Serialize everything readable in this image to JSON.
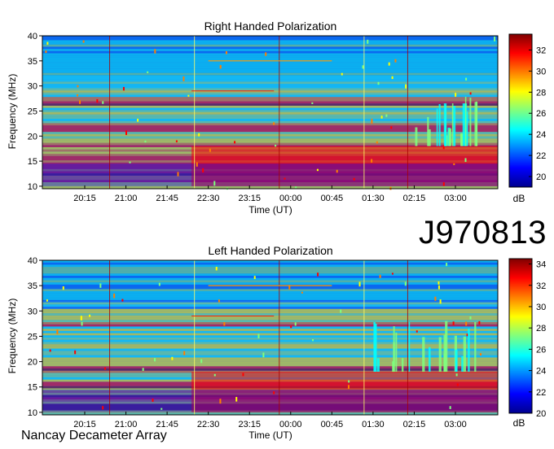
{
  "identifier": "J970813",
  "footer": "Nancay Decameter Array",
  "colors": {
    "colormap": [
      "#00008f",
      "#0000ff",
      "#007fff",
      "#00ffff",
      "#7fff7f",
      "#ffff00",
      "#ff7f00",
      "#ff0000",
      "#7f0000"
    ]
  },
  "chart_data": [
    {
      "type": "heatmap",
      "title": "Right Handed Polarization",
      "xlabel": "Time (UT)",
      "ylabel": "Frequency (MHz)",
      "x_ticks": [
        "20:15",
        "21:00",
        "21:45",
        "22:30",
        "23:15",
        "00:00",
        "00:45",
        "01:30",
        "02:15",
        "03:00"
      ],
      "y_ticks": [
        10,
        15,
        20,
        25,
        30,
        35,
        40
      ],
      "ylim": [
        9.5,
        40
      ],
      "colorbar": {
        "label": "dB",
        "ticks": [
          20,
          22,
          24,
          26,
          28,
          30,
          32
        ],
        "range": [
          19,
          33.5
        ]
      },
      "intense_bands_mhz": [
        [
          10,
          18.5
        ],
        [
          20.5,
          22.5
        ],
        [
          26,
          27.5
        ]
      ],
      "burst_window_ut": [
        "02:15",
        "03:00"
      ]
    },
    {
      "type": "heatmap",
      "title": "Left Handed Polarization",
      "xlabel": "Time (UT)",
      "ylabel": "Frequency (MHz)",
      "x_ticks": [
        "20:15",
        "21:00",
        "21:45",
        "22:30",
        "23:15",
        "00:00",
        "00:45",
        "01:30",
        "02:15",
        "03:00"
      ],
      "y_ticks": [
        10,
        15,
        20,
        25,
        30,
        35,
        40
      ],
      "ylim": [
        9.5,
        40
      ],
      "colorbar": {
        "label": "dB",
        "ticks": [
          20,
          22,
          24,
          26,
          28,
          30,
          32,
          34
        ],
        "range": [
          20,
          34.5
        ]
      },
      "intense_bands_mhz": [
        [
          10,
          16
        ],
        [
          17.5,
          19.5
        ],
        [
          26.5,
          27.5
        ]
      ],
      "burst_window_ut": [
        "01:30",
        "03:00"
      ]
    }
  ]
}
